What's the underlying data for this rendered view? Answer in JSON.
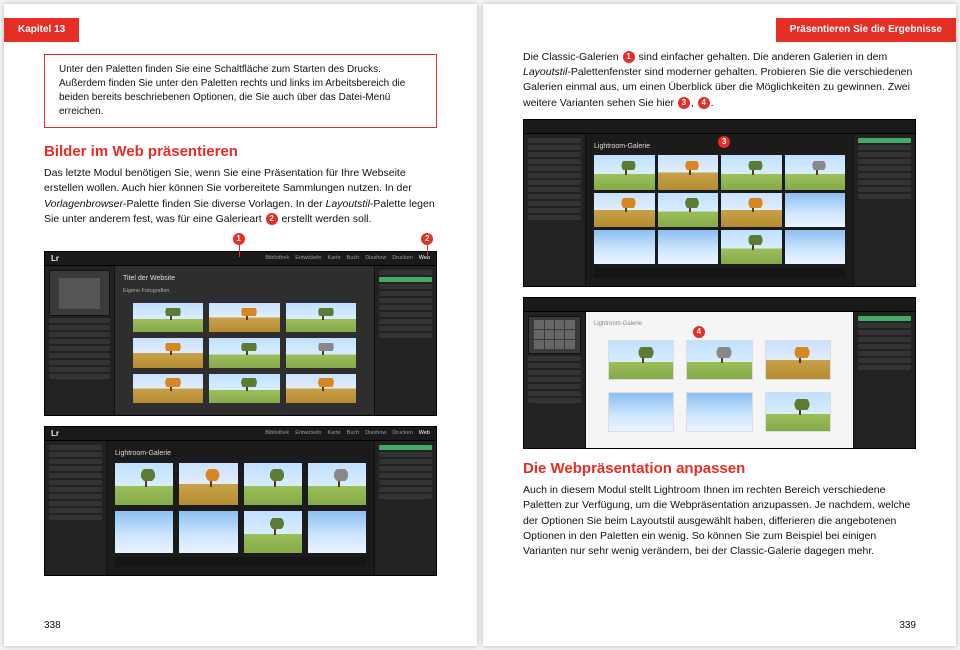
{
  "left": {
    "chapter": "Kapitel 13",
    "info": "Unter den Paletten finden Sie eine Schaltfläche zum Starten des Drucks. Außerdem finden Sie unter den Paletten rechts und links im Arbeitsbereich die beiden bereits beschriebenen Optionen, die Sie auch über das Datei-Menü erreichen.",
    "h2": "Bilder im Web präsentieren",
    "p1a": "Das letzte Modul benötigen Sie, wenn Sie eine Präsentation für Ihre Webseite erstellen wollen. Auch hier können Sie vorbereitete Sammlungen nutzen. In der ",
    "p1b": "Vorlagenbrowser",
    "p1c": "-Palette finden Sie diverse Vorlagen. In der ",
    "p1d": "Layoutstil",
    "p1e": "-Palette legen Sie unter anderem fest, was für eine Galerieart ",
    "p1f": " erstellt werden soll.",
    "shot1": {
      "lr": "Lr",
      "tabs": [
        "Bibliothek",
        "Entwickeln",
        "Karte",
        "Buch",
        "Diashow",
        "Drucken",
        "Web"
      ],
      "title": "Titel der Website",
      "subtitle": "Eigene Fotografien"
    },
    "shot2": {
      "lr": "Lr",
      "title": "Lightroom-Galerie"
    },
    "pagenum": "338"
  },
  "right": {
    "tab": "Präsentieren Sie die Ergebnisse",
    "p1a": "Die Classic-Galerien ",
    "p1b": " sind einfacher gehalten. Die anderen Galerien in dem ",
    "p1c": "Layoutstil",
    "p1d": "-Palettenfenster sind moderner gehalten. Probieren Sie die verschiedenen Galerien einmal aus, um einen Überblick über die Möglichkeiten zu gewinnen. Zwei weitere Varianten sehen Sie hier ",
    "p1e": ", ",
    "p1f": ".",
    "shot3": {
      "title": "Lightroom-Galerie"
    },
    "shot4": {
      "title": "Lightroom-Galerie"
    },
    "h2": "Die Webpräsentation anpassen",
    "p2": "Auch in diesem Modul stellt Lightroom Ihnen im rechten Bereich verschiedene Paletten zur Verfügung, um die Webpräsentation anzupassen. Je nachdem, welche der Optionen Sie beim Layoutstil ausgewählt haben, differieren die angebotenen Optionen in den Paletten ein wenig. So können Sie zum Beispiel bei einigen Varianten nur sehr wenig verändern, bei der Classic-Galerie dagegen mehr.",
    "pagenum": "339"
  },
  "bullets": {
    "b1": "1",
    "b2": "2",
    "b3": "3",
    "b4": "4"
  }
}
